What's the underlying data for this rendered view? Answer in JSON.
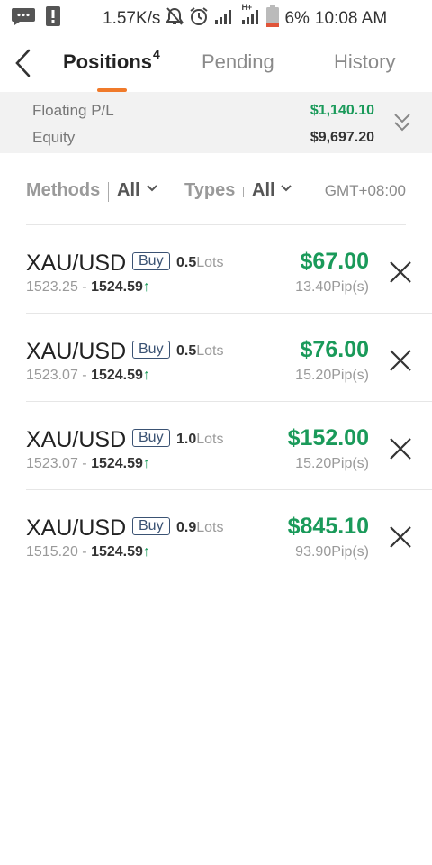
{
  "status_bar": {
    "net_speed": "1.57K/s",
    "network": "H+",
    "battery": "6%",
    "time": "10:08 AM"
  },
  "header": {
    "tabs": [
      {
        "label": "Positions",
        "badge": "4",
        "active": true
      },
      {
        "label": "Pending",
        "active": false
      },
      {
        "label": "History",
        "active": false
      }
    ],
    "accent_color": "#f07a2a"
  },
  "summary": {
    "floating_label": "Floating P/L",
    "floating_value": "$1,140.10",
    "equity_label": "Equity",
    "equity_value": "$9,697.20",
    "profit_color": "#1a9a5a"
  },
  "filters": {
    "methods_label": "Methods",
    "methods_value": "All",
    "types_label": "Types",
    "types_value": "All",
    "timezone": "GMT+08:00"
  },
  "positions": [
    {
      "symbol": "XAU/USD",
      "side": "Buy",
      "lots": "0.5",
      "lots_unit": "Lots",
      "open_price": "1523.25",
      "current_price": "1524.59",
      "pnl": "$67.00",
      "pips": "13.40Pip(s)"
    },
    {
      "symbol": "XAU/USD",
      "side": "Buy",
      "lots": "0.5",
      "lots_unit": "Lots",
      "open_price": "1523.07",
      "current_price": "1524.59",
      "pnl": "$76.00",
      "pips": "15.20Pip(s)"
    },
    {
      "symbol": "XAU/USD",
      "side": "Buy",
      "lots": "1.0",
      "lots_unit": "Lots",
      "open_price": "1523.07",
      "current_price": "1524.59",
      "pnl": "$152.00",
      "pips": "15.20Pip(s)"
    },
    {
      "symbol": "XAU/USD",
      "side": "Buy",
      "lots": "0.9",
      "lots_unit": "Lots",
      "open_price": "1515.20",
      "current_price": "1524.59",
      "pnl": "$845.10",
      "pips": "93.90Pip(s)"
    }
  ],
  "common": {
    "price_separator": " - ",
    "up_arrow": "↑"
  }
}
